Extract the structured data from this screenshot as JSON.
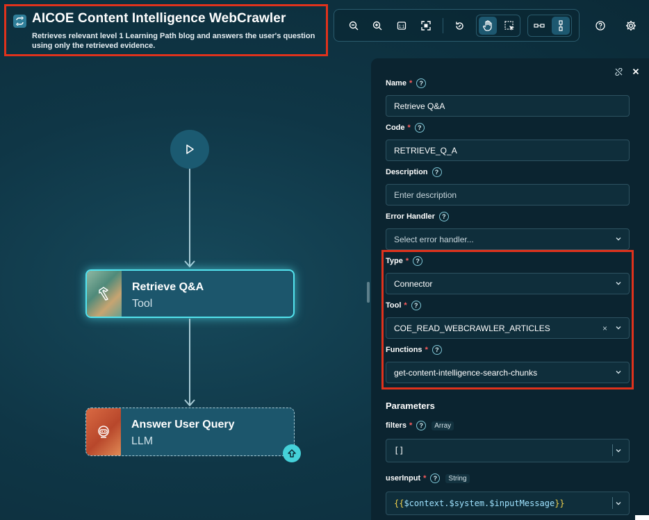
{
  "header": {
    "title": "AICOE Content Intelligence WebCrawler",
    "subtitle": "Retrieves relevant level 1 Learning Path blog and answers the user's question using only the retrieved evidence."
  },
  "toolbar": {
    "icons": [
      "zoom-out-icon",
      "zoom-in-icon",
      "actual-size-icon",
      "fit-view-icon",
      "reset-icon",
      "pan-hand-icon",
      "select-icon",
      "horizontal-layout-icon",
      "vertical-layout-icon",
      "help-icon",
      "settings-icon"
    ]
  },
  "canvas": {
    "start_node": {
      "icon": "play-icon"
    },
    "nodes": [
      {
        "title": "Retrieve Q&A",
        "subtitle": "Tool",
        "icon": "hammer-icon"
      },
      {
        "title": "Answer User Query",
        "subtitle": "LLM",
        "icon": "robot-icon"
      }
    ]
  },
  "panel": {
    "name": {
      "label": "Name",
      "value": "Retrieve Q&A"
    },
    "code": {
      "label": "Code",
      "value": "RETRIEVE_Q_A"
    },
    "description": {
      "label": "Description",
      "placeholder": "Enter description"
    },
    "error_handler": {
      "label": "Error Handler",
      "placeholder": "Select error handler..."
    },
    "type": {
      "label": "Type",
      "value": "Connector"
    },
    "tool": {
      "label": "Tool",
      "value": "COE_READ_WEBCRAWLER_ARTICLES"
    },
    "functions": {
      "label": "Functions",
      "value": "get-content-intelligence-search-chunks"
    },
    "parameters_title": "Parameters",
    "parameters": [
      {
        "label": "filters",
        "type": "Array",
        "value": "[]"
      },
      {
        "label": "userInput",
        "type": "String",
        "value": "{{$context.$system.$inputMessage}}"
      }
    ],
    "colors": {
      "highlight": "#e0321c",
      "selected_node_glow": "#53e3ee",
      "required": "#ff5c5c"
    }
  }
}
